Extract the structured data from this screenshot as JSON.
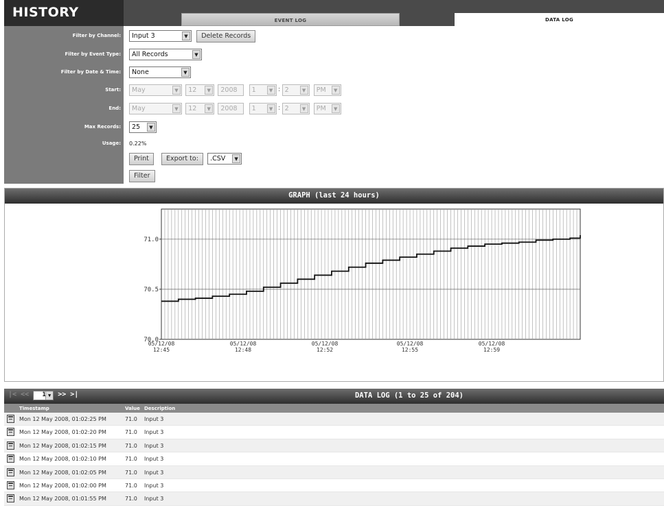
{
  "header": {
    "title": "HISTORY",
    "tabs": [
      {
        "label": "EVENT LOG",
        "active": false
      },
      {
        "label": "DATA LOG",
        "active": true
      }
    ]
  },
  "filters": {
    "channel": {
      "label": "Filter by Channel:",
      "value": "Input 3",
      "delete_label": "Delete Records"
    },
    "event_type": {
      "label": "Filter by Event Type:",
      "value": "All Records"
    },
    "date_time": {
      "label": "Filter by Date & Time:",
      "value": "None"
    },
    "start": {
      "label": "Start:",
      "month": "May",
      "day": "12",
      "year": "2008",
      "hour": "1",
      "minute": "2",
      "ampm": "PM"
    },
    "end": {
      "label": "End:",
      "month": "May",
      "day": "12",
      "year": "2008",
      "hour": "1",
      "minute": "2",
      "ampm": "PM"
    },
    "max_records": {
      "label": "Max Records:",
      "value": "25"
    },
    "usage": {
      "label": "Usage:",
      "value": "0.22%"
    },
    "print_label": "Print",
    "export_label": "Export to:",
    "export_format": ".CSV",
    "filter_label": "Filter"
  },
  "graph": {
    "title": "GRAPH (last 24 hours)"
  },
  "chart_data": {
    "type": "line",
    "title": "GRAPH (last 24 hours)",
    "xlabel": "",
    "ylabel": "",
    "ylim": [
      70.0,
      71.3
    ],
    "xlim": [
      0,
      123
    ],
    "yticks": [
      70.0,
      70.5,
      71.0
    ],
    "ytick_labels": [
      "70.0",
      "70.5",
      "71.0"
    ],
    "xticks": [
      {
        "x": 0,
        "label": [
          "05/12/08",
          "12:45"
        ]
      },
      {
        "x": 24,
        "label": [
          "05/12/08",
          "12:48"
        ]
      },
      {
        "x": 48,
        "label": [
          "05/12/08",
          "12:52"
        ]
      },
      {
        "x": 73,
        "label": [
          "05/12/08",
          "12:55"
        ]
      },
      {
        "x": 97,
        "label": [
          "05/12/08",
          "12:59"
        ]
      }
    ],
    "grid": true,
    "series": [
      {
        "values": [
          70.38,
          70.4,
          70.41,
          70.43,
          70.45,
          70.48,
          70.52,
          70.56,
          70.6,
          70.64,
          70.68,
          70.72,
          70.76,
          70.79,
          70.82,
          70.85,
          70.88,
          70.91,
          70.93,
          70.95,
          70.96,
          70.97,
          70.99,
          71.0,
          71.01,
          71.04
        ],
        "x": [
          0,
          5,
          10,
          15,
          20,
          25,
          30,
          35,
          40,
          45,
          50,
          55,
          60,
          65,
          70,
          75,
          80,
          85,
          90,
          95,
          100,
          105,
          110,
          115,
          120,
          123
        ]
      }
    ]
  },
  "log": {
    "pager": {
      "first": "|<",
      "prev": "<<",
      "page": "1",
      "next": ">>",
      "last": ">|"
    },
    "title": "DATA LOG (1 to 25 of 204)",
    "columns": {
      "timestamp": "Timestamp",
      "value": "Value",
      "description": "Description"
    },
    "rows": [
      {
        "timestamp": "Mon 12 May 2008, 01:02:25 PM",
        "value": "71.0",
        "description": "Input 3"
      },
      {
        "timestamp": "Mon 12 May 2008, 01:02:20 PM",
        "value": "71.0",
        "description": "Input 3"
      },
      {
        "timestamp": "Mon 12 May 2008, 01:02:15 PM",
        "value": "71.0",
        "description": "Input 3"
      },
      {
        "timestamp": "Mon 12 May 2008, 01:02:10 PM",
        "value": "71.0",
        "description": "Input 3"
      },
      {
        "timestamp": "Mon 12 May 2008, 01:02:05 PM",
        "value": "71.0",
        "description": "Input 3"
      },
      {
        "timestamp": "Mon 12 May 2008, 01:02:00 PM",
        "value": "71.0",
        "description": "Input 3"
      },
      {
        "timestamp": "Mon 12 May 2008, 01:01:55 PM",
        "value": "71.0",
        "description": "Input 3"
      }
    ]
  }
}
